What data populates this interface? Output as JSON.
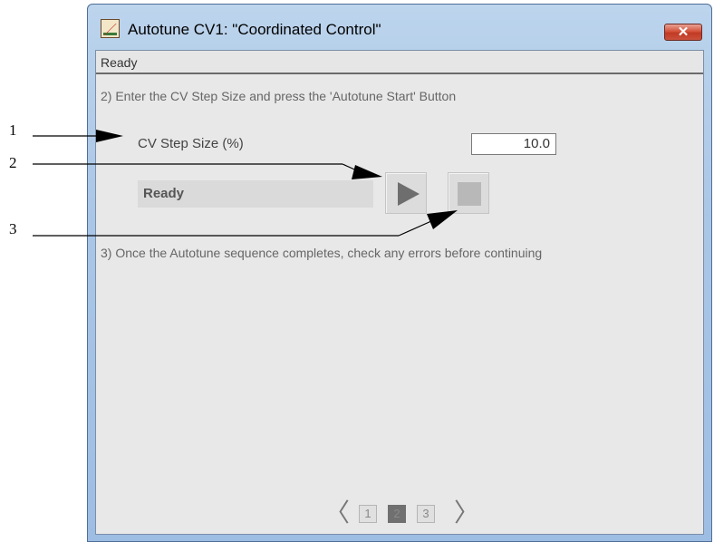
{
  "window": {
    "title": "Autotune CV1:  \"Coordinated Control\"",
    "close_label": "✕",
    "app_icon": "autotune-chart-icon"
  },
  "status": {
    "text": "Ready"
  },
  "steps": {
    "step2": "2) Enter the CV Step Size and press the 'Autotune Start' Button",
    "step3": "3) Once the Autotune sequence completes, check any errors before continuing"
  },
  "cv_step": {
    "label": "CV Step Size (%)",
    "value": "10.0"
  },
  "autotune": {
    "state": "Ready",
    "start_icon": "play-icon",
    "stop_icon": "stop-icon"
  },
  "pager": {
    "prev": "〈",
    "next": "〉",
    "pages": [
      "1",
      "2",
      "3"
    ],
    "current": "2"
  },
  "callouts": [
    "1",
    "2",
    "3"
  ]
}
